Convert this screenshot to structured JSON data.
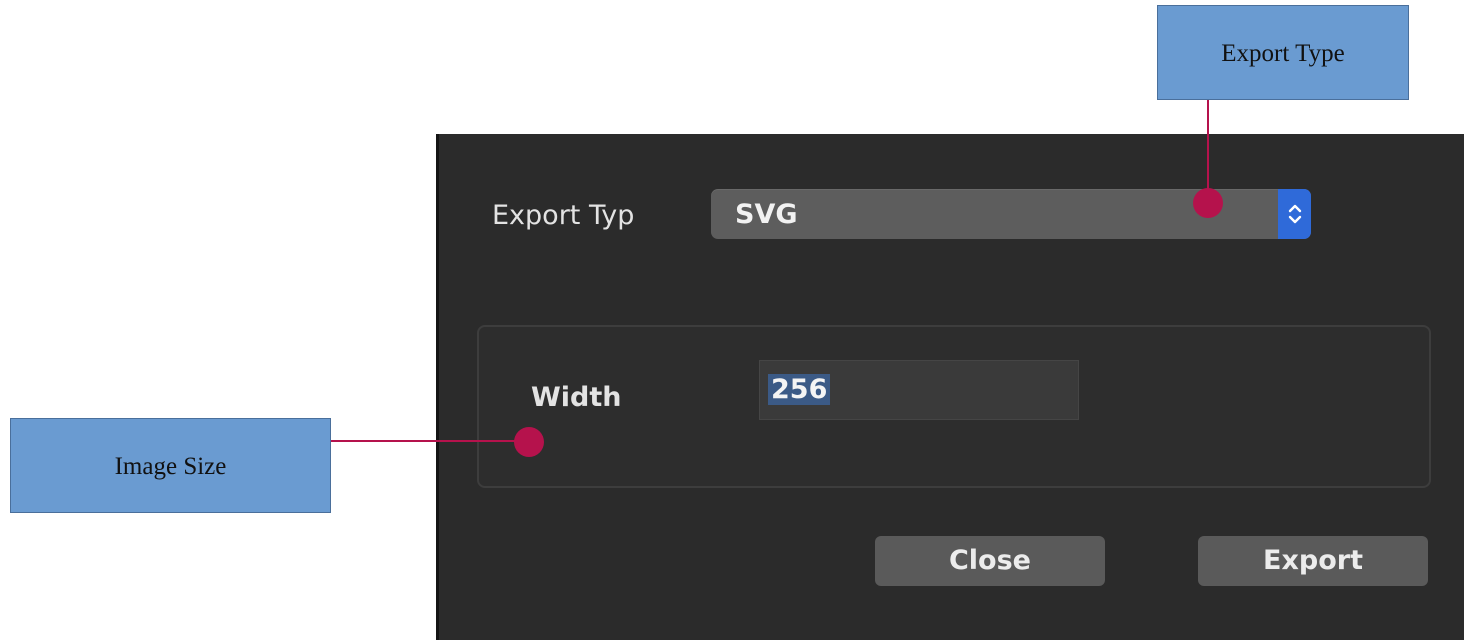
{
  "dialog": {
    "export_type_label": "Export Typ",
    "export_type_value": "SVG",
    "width_label": "Width",
    "width_value": "256",
    "close_button": "Close",
    "export_button": "Export"
  },
  "annotations": {
    "export_type": "Export Type",
    "image_size": "Image Size"
  },
  "colors": {
    "dialog_background": "#2b2b2b",
    "select_accent": "#2f6ad9",
    "callout_fill": "#6a9bd1",
    "leader_color": "#b5124c"
  },
  "icons": {
    "select_stepper": "chevron-up-down-icon"
  }
}
